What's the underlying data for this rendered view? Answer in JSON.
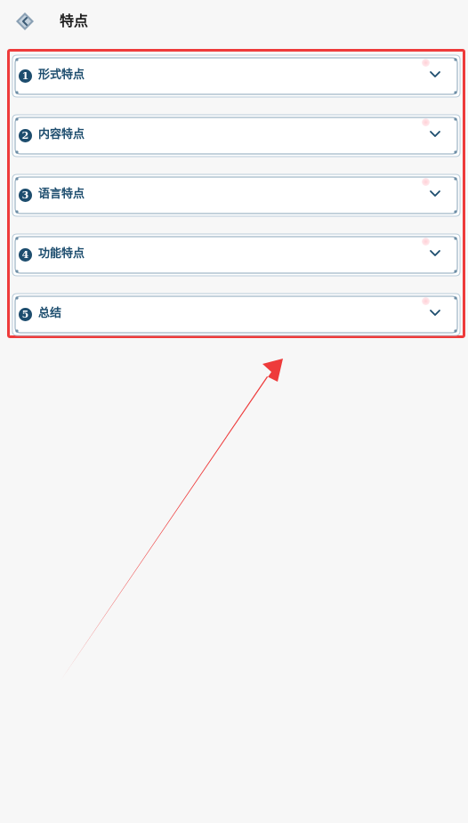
{
  "header": {
    "title": "特点",
    "back_icon": "back-arrow-icon"
  },
  "sections": [
    {
      "number": "1",
      "label": "形式特点"
    },
    {
      "number": "2",
      "label": "内容特点"
    },
    {
      "number": "3",
      "label": "语言特点"
    },
    {
      "number": "4",
      "label": "功能特点"
    },
    {
      "number": "5",
      "label": "总结"
    }
  ],
  "colors": {
    "accent": "#1d4d6e",
    "highlight": "#ee3b3b",
    "background": "#f7f7f7"
  }
}
